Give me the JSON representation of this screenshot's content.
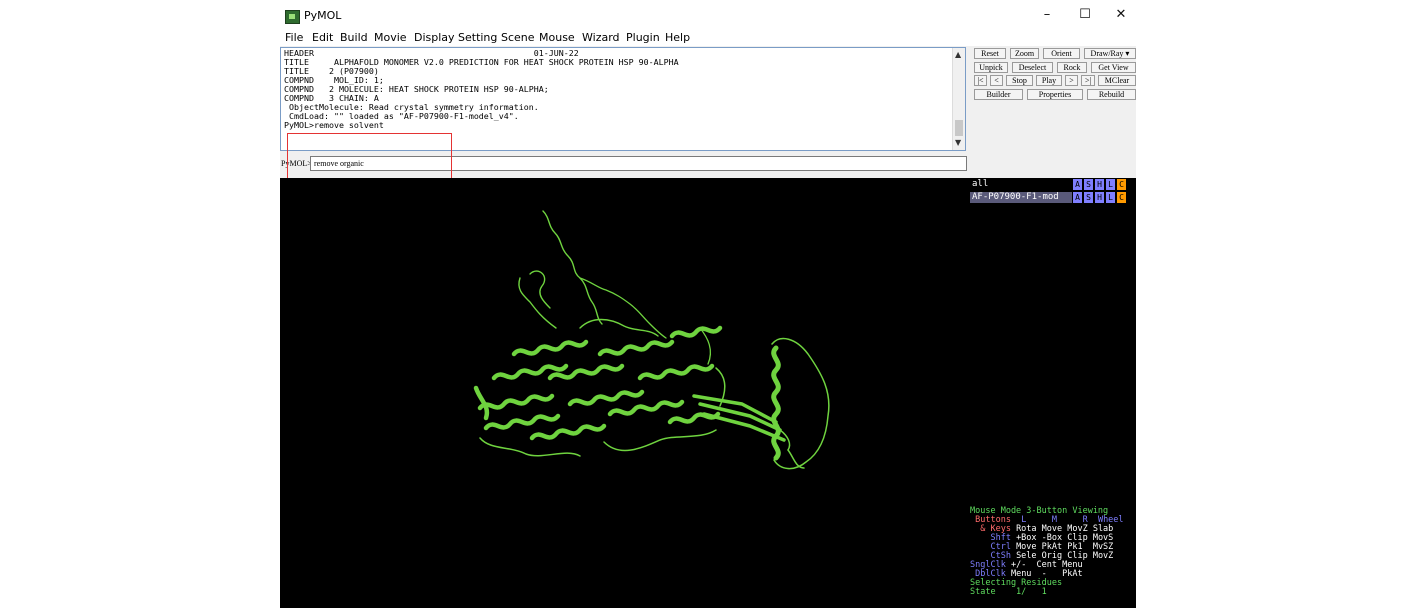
{
  "window": {
    "title": "PyMOL",
    "controls": {
      "minimize": "–",
      "maximize": "☐",
      "close": "✕"
    }
  },
  "menu": [
    "File",
    "Edit",
    "Build",
    "Movie",
    "Display",
    "Setting",
    "Scene",
    "Mouse",
    "Wizard",
    "Plugin",
    "Help"
  ],
  "output_lines": [
    "HEADER                                            01-JUN-22",
    "TITLE     ALPHAFOLD MONOMER V2.0 PREDICTION FOR HEAT SHOCK PROTEIN HSP 90-ALPHA",
    "TITLE    2 (P07900)",
    "COMPND    MOL_ID: 1;",
    "COMPND   2 MOLECULE: HEAT SHOCK PROTEIN HSP 90-ALPHA;",
    "COMPND   3 CHAIN: A",
    " ObjectMolecule: Read crystal symmetry information.",
    " CmdLoad: \"\" loaded as \"AF-P07900-F1-model_v4\".",
    "PyMOL>remove solvent"
  ],
  "command": {
    "prompt": "PyMOL>",
    "value": "remove organic"
  },
  "buttons": {
    "row1": [
      "Reset",
      "Zoom",
      "Orient",
      "Draw/Ray ▾"
    ],
    "row2": [
      "Unpick",
      "Deselect",
      "Rock",
      "Get View"
    ],
    "row3": [
      "|<",
      "<",
      "Stop",
      "Play",
      ">",
      ">|",
      "MClear"
    ],
    "row4": [
      "Builder",
      "Properties",
      "Rebuild"
    ]
  },
  "objects": [
    {
      "name": "all",
      "flags": [
        "A",
        "S",
        "H",
        "L",
        "C"
      ]
    },
    {
      "name": "AF-P07900-F1-mod",
      "flags": [
        "A",
        "S",
        "H",
        "L",
        "C"
      ]
    }
  ],
  "mouse_info": [
    {
      "parts": [
        [
          "Mouse Mode 3-Button Viewing",
          "#5fdc5f"
        ]
      ]
    },
    {
      "parts": [
        [
          " Buttons  ",
          "#ff6b6b"
        ],
        [
          "L     M     R  Wheel",
          "#7f7fff"
        ]
      ]
    },
    {
      "parts": [
        [
          "  & Keys ",
          "#ff6b6b"
        ],
        [
          "Rota Move MovZ Slab",
          "#ffffff"
        ]
      ]
    },
    {
      "parts": [
        [
          "    Shft ",
          "#7f7fff"
        ],
        [
          "+Box -Box Clip MovS",
          "#ffffff"
        ]
      ]
    },
    {
      "parts": [
        [
          "    Ctrl ",
          "#7f7fff"
        ],
        [
          "Move PkAt Pk1  MvSZ",
          "#ffffff"
        ]
      ]
    },
    {
      "parts": [
        [
          "    CtSh ",
          "#7f7fff"
        ],
        [
          "Sele Orig Clip MovZ",
          "#ffffff"
        ]
      ]
    },
    {
      "parts": [
        [
          "SnglClk ",
          "#7f7fff"
        ],
        [
          "+/-  Cent Menu",
          "#ffffff"
        ]
      ]
    },
    {
      "parts": [
        [
          " DblClk ",
          "#7f7fff"
        ],
        [
          "Menu  -   PkAt",
          "#ffffff"
        ]
      ]
    },
    {
      "parts": [
        [
          "Selecting Residues",
          "#5fdc5f"
        ]
      ]
    },
    {
      "parts": [
        [
          "State    1/   1",
          "#5fdc5f"
        ]
      ]
    }
  ],
  "colors": {
    "protein": "#6fd33f",
    "highlight_box": "#e43333",
    "selected_object": "#5a5a7a",
    "flag_a": "#7f7fff",
    "flag_s": "#7f7fff",
    "flag_h": "#7f7fff",
    "flag_l": "#7f7fff",
    "flag_c": "#ff9a00"
  }
}
